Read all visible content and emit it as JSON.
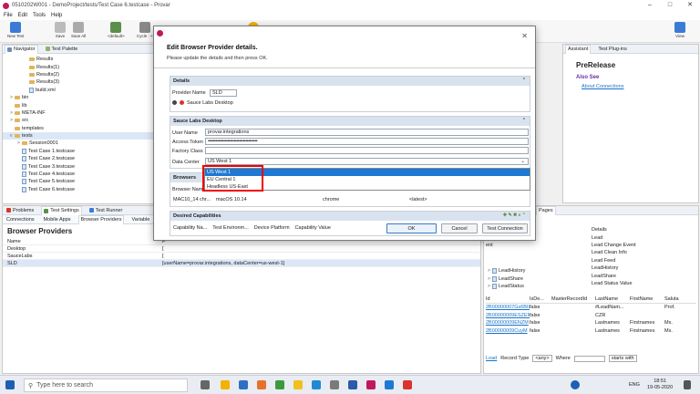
{
  "window": {
    "title": "0510202W001 - DemoProject/tests/Test Case 6.testcase - Provar",
    "controls": [
      "–",
      "□",
      "✕"
    ]
  },
  "menu": [
    "File",
    "Edit",
    "Tools",
    "Help"
  ],
  "toolbar": {
    "new_test": "New Test",
    "save": "Save",
    "save_all": "Save All",
    "default_select": "<default>",
    "cycle": "Cycle : <",
    "view": "View"
  },
  "navigator": {
    "tabs": [
      "Navigator",
      "Test Palette"
    ],
    "items": [
      {
        "label": "Results",
        "indent": 3,
        "type": "folder",
        "chev": ""
      },
      {
        "label": "Results(1)",
        "indent": 3,
        "type": "folder",
        "chev": ""
      },
      {
        "label": "Results(2)",
        "indent": 3,
        "type": "folder",
        "chev": ""
      },
      {
        "label": "Results(3)",
        "indent": 3,
        "type": "folder",
        "chev": ""
      },
      {
        "label": "build.xml",
        "indent": 3,
        "type": "file",
        "chev": ""
      },
      {
        "label": "bin",
        "indent": 1,
        "type": "folder",
        "chev": ">"
      },
      {
        "label": "lib",
        "indent": 1,
        "type": "folder",
        "chev": ""
      },
      {
        "label": "META-INF",
        "indent": 1,
        "type": "folder",
        "chev": ">"
      },
      {
        "label": "src",
        "indent": 1,
        "type": "folder",
        "chev": ">"
      },
      {
        "label": "templates",
        "indent": 1,
        "type": "folder",
        "chev": ""
      },
      {
        "label": "tests",
        "indent": 1,
        "type": "folder",
        "chev": "v"
      },
      {
        "label": "Session0001",
        "indent": 2,
        "type": "folder",
        "chev": ">"
      },
      {
        "label": "Test Case 1.testcase",
        "indent": 2,
        "type": "file",
        "chev": ""
      },
      {
        "label": "Test Case 2.testcase",
        "indent": 2,
        "type": "file",
        "chev": ""
      },
      {
        "label": "Test Case 3.testcase",
        "indent": 2,
        "type": "file",
        "chev": ""
      },
      {
        "label": "Test Case 4.testcase",
        "indent": 2,
        "type": "file",
        "chev": ""
      },
      {
        "label": "Test Case 5.testcase",
        "indent": 2,
        "type": "file",
        "chev": ""
      },
      {
        "label": "Test Case 6.testcase",
        "indent": 2,
        "type": "file",
        "chev": ""
      }
    ]
  },
  "bottom_tabs": [
    "Problems",
    "Test Settings",
    "Test Runner"
  ],
  "bottom_subtabs": [
    "Connections",
    "Mobile Apps",
    "Browser Providers",
    "Variable"
  ],
  "browser_providers": {
    "title": "Browser Providers",
    "rows": [
      {
        "name": "Name",
        "value": "F"
      },
      {
        "name": "Desktop",
        "value": "["
      },
      {
        "name": "SauceLabs",
        "value": "["
      },
      {
        "name": "SLD",
        "value": "[userName=provar.integrations, dataCenter=us-west-1]"
      }
    ]
  },
  "right_panel": {
    "tabs": [
      "Assistant",
      "Test Plug-ins"
    ],
    "heading": "PreRelease",
    "also_see": "Also See",
    "link": "About Connections"
  },
  "org_browser": {
    "tab": "Pages",
    "details_items": [
      "Details",
      "Lead",
      "Lead Change Event",
      "Lead Clean Info",
      "Lead Feed",
      "LeadHistory",
      "LeadShare",
      "Lead Status Value"
    ],
    "partial_label": "ent",
    "tree_items": [
      "LeadHistory",
      "LeadShare",
      "LeadStatus"
    ],
    "grid_headers": [
      "Id",
      "IsDe...",
      "MasterRecordId",
      "LastName",
      "FirstName",
      "Saluta"
    ],
    "grid_rows": [
      [
        "2B00000007Gx6BIL",
        "false",
        "",
        "#LeadNam...",
        "",
        "Prof."
      ],
      [
        "2B00000009ESZEM",
        "false",
        "",
        "CZR",
        "",
        ""
      ],
      [
        "2B00000009ENZM",
        "false",
        "",
        "Lastnames",
        "Firstnames",
        "Ms."
      ],
      [
        "2B00000009CuyM",
        "false",
        "",
        "Lastnames",
        "Firstnames",
        "Ms."
      ]
    ],
    "footer": {
      "load": "Load",
      "record_type_label": "Record Type",
      "record_type_value": "<any>",
      "where": "Where",
      "starts_with": "starts with"
    }
  },
  "dialog": {
    "title": "Edit Browser Provider details.",
    "subtitle": "Please update the details and then press OK.",
    "details_section": "Details",
    "provider_name_label": "Provider Name",
    "provider_name_value": "SLD",
    "radio_label": "Sauce Labs Desktop",
    "sauce_section": "Sauce Labs Desktop",
    "user_name_label": "User Name",
    "user_name_value": "provar.integrations",
    "access_token_label": "Access Token",
    "access_token_value": "••••••••••••••••••••••••••••••••••••••",
    "factory_class_label": "Factory Class",
    "factory_class_value": "",
    "data_center_label": "Data Center",
    "data_center_value": "US West 1",
    "browsers_section": "Browsers",
    "browser_name_header": "Browser Nam",
    "browser_row": {
      "name": "MAC10_14 chr...",
      "os": "macOS 10.14",
      "browser": "chrome",
      "version": "<latest>"
    },
    "desired_section": "Desired Capabilities",
    "capability_headers": [
      "Capability Na...",
      "Test Environm...",
      "Device Platform",
      "Capability Value"
    ],
    "buttons": {
      "ok": "OK",
      "cancel": "Cancel",
      "test": "Test Connection"
    }
  },
  "data_center_options": [
    "US West 1",
    "EU Central 1",
    "Headless US-East"
  ],
  "taskbar": {
    "search_placeholder": "Type here to search",
    "lang": "ENG",
    "time": "18:51",
    "date": "19-05-2020"
  },
  "colors": {
    "accent": "#1e78d4",
    "section_header": "#d9e3ef",
    "highlight_box": "#e00000",
    "error_icon": "#d9342b"
  }
}
